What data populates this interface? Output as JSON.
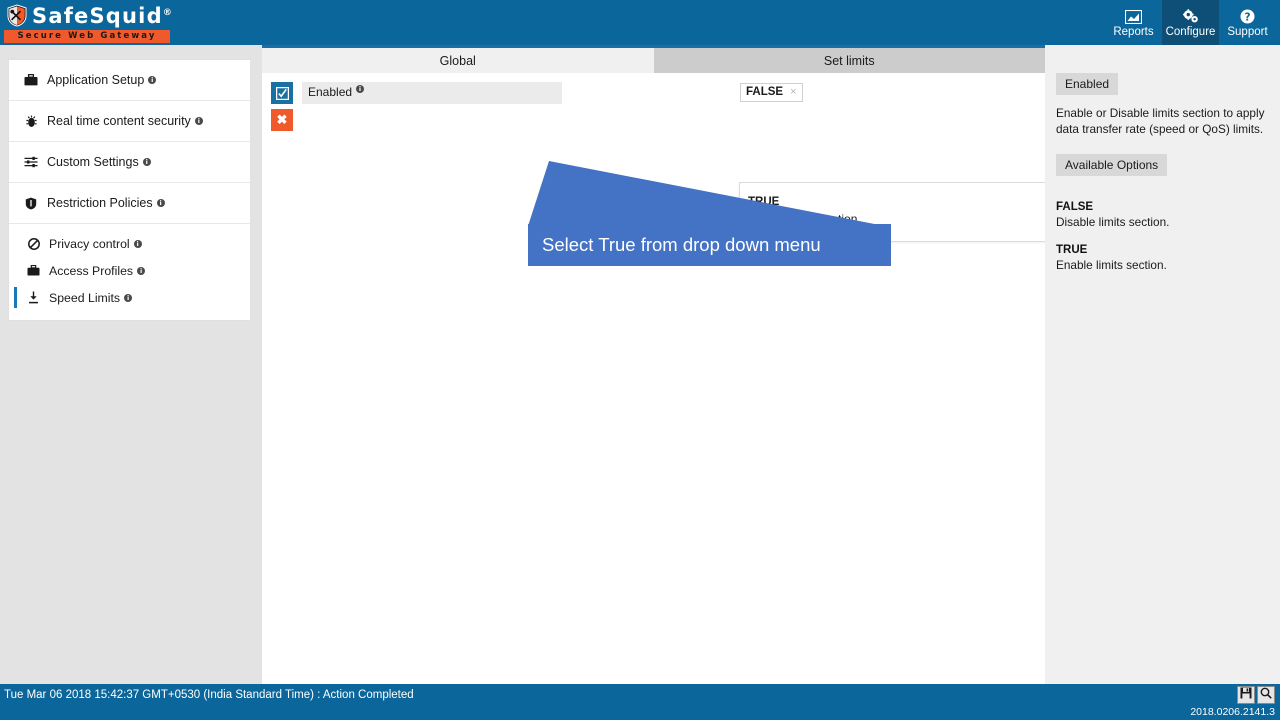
{
  "header": {
    "logo_text": "SafeSquid",
    "logo_reg": "®",
    "logo_tagline": "Secure Web Gateway",
    "nav": [
      {
        "label": "Reports",
        "icon": "reports-chart-icon",
        "active": false
      },
      {
        "label": "Configure",
        "icon": "gears-icon",
        "active": true
      },
      {
        "label": "Support",
        "icon": "question-circle-icon",
        "active": false
      }
    ]
  },
  "sidebar": {
    "groups": [
      {
        "items": [
          {
            "label": "Application Setup",
            "icon": "briefcase-icon",
            "selected": false
          }
        ]
      },
      {
        "items": [
          {
            "label": "Real time content security",
            "icon": "bug-shield-icon",
            "selected": false
          }
        ]
      },
      {
        "items": [
          {
            "label": "Custom Settings",
            "icon": "sliders-icon",
            "selected": false
          }
        ]
      },
      {
        "items": [
          {
            "label": "Restriction Policies",
            "icon": "shield-icon",
            "selected": false
          }
        ]
      },
      {
        "items": [
          {
            "label": "Privacy control",
            "icon": "ban-circle-icon",
            "selected": false
          },
          {
            "label": "Access Profiles",
            "icon": "briefcase-icon",
            "selected": false
          },
          {
            "label": "Speed Limits",
            "icon": "speed-gauge-icon",
            "selected": true
          }
        ]
      }
    ]
  },
  "tabs": [
    {
      "label": "Global",
      "active": true
    },
    {
      "label": "Set limits",
      "active": false
    }
  ],
  "form": {
    "row": {
      "check_button": "☑",
      "delete_button": "✖",
      "label": "Enabled",
      "tag_value": "FALSE",
      "tag_remove": "×"
    },
    "dropdown": {
      "option_name": "TRUE",
      "option_desc": "Enable limits section."
    }
  },
  "callout": {
    "text": "Select True from drop down menu",
    "color": "#4472c4"
  },
  "help": {
    "title_badge": "Enabled",
    "description": "Enable or Disable limits section to apply data transfer rate (speed or QoS) limits.",
    "options_badge": "Available Options",
    "options": [
      {
        "name": "FALSE",
        "desc": "Disable limits section."
      },
      {
        "name": "TRUE",
        "desc": "Enable limits section."
      }
    ]
  },
  "footer": {
    "status": "Tue Mar 06 2018 15:42:37 GMT+0530 (India Standard Time) : Action Completed",
    "version": "2018.0206.2141.3",
    "tools": [
      {
        "name": "save-icon"
      },
      {
        "name": "search-icon"
      }
    ]
  },
  "colors": {
    "header_blue": "#0a669b",
    "accent_orange": "#f0592b",
    "tab_active": "#f0f0f0",
    "tab_inactive": "#cccccc",
    "callout_blue": "#4472c4"
  }
}
